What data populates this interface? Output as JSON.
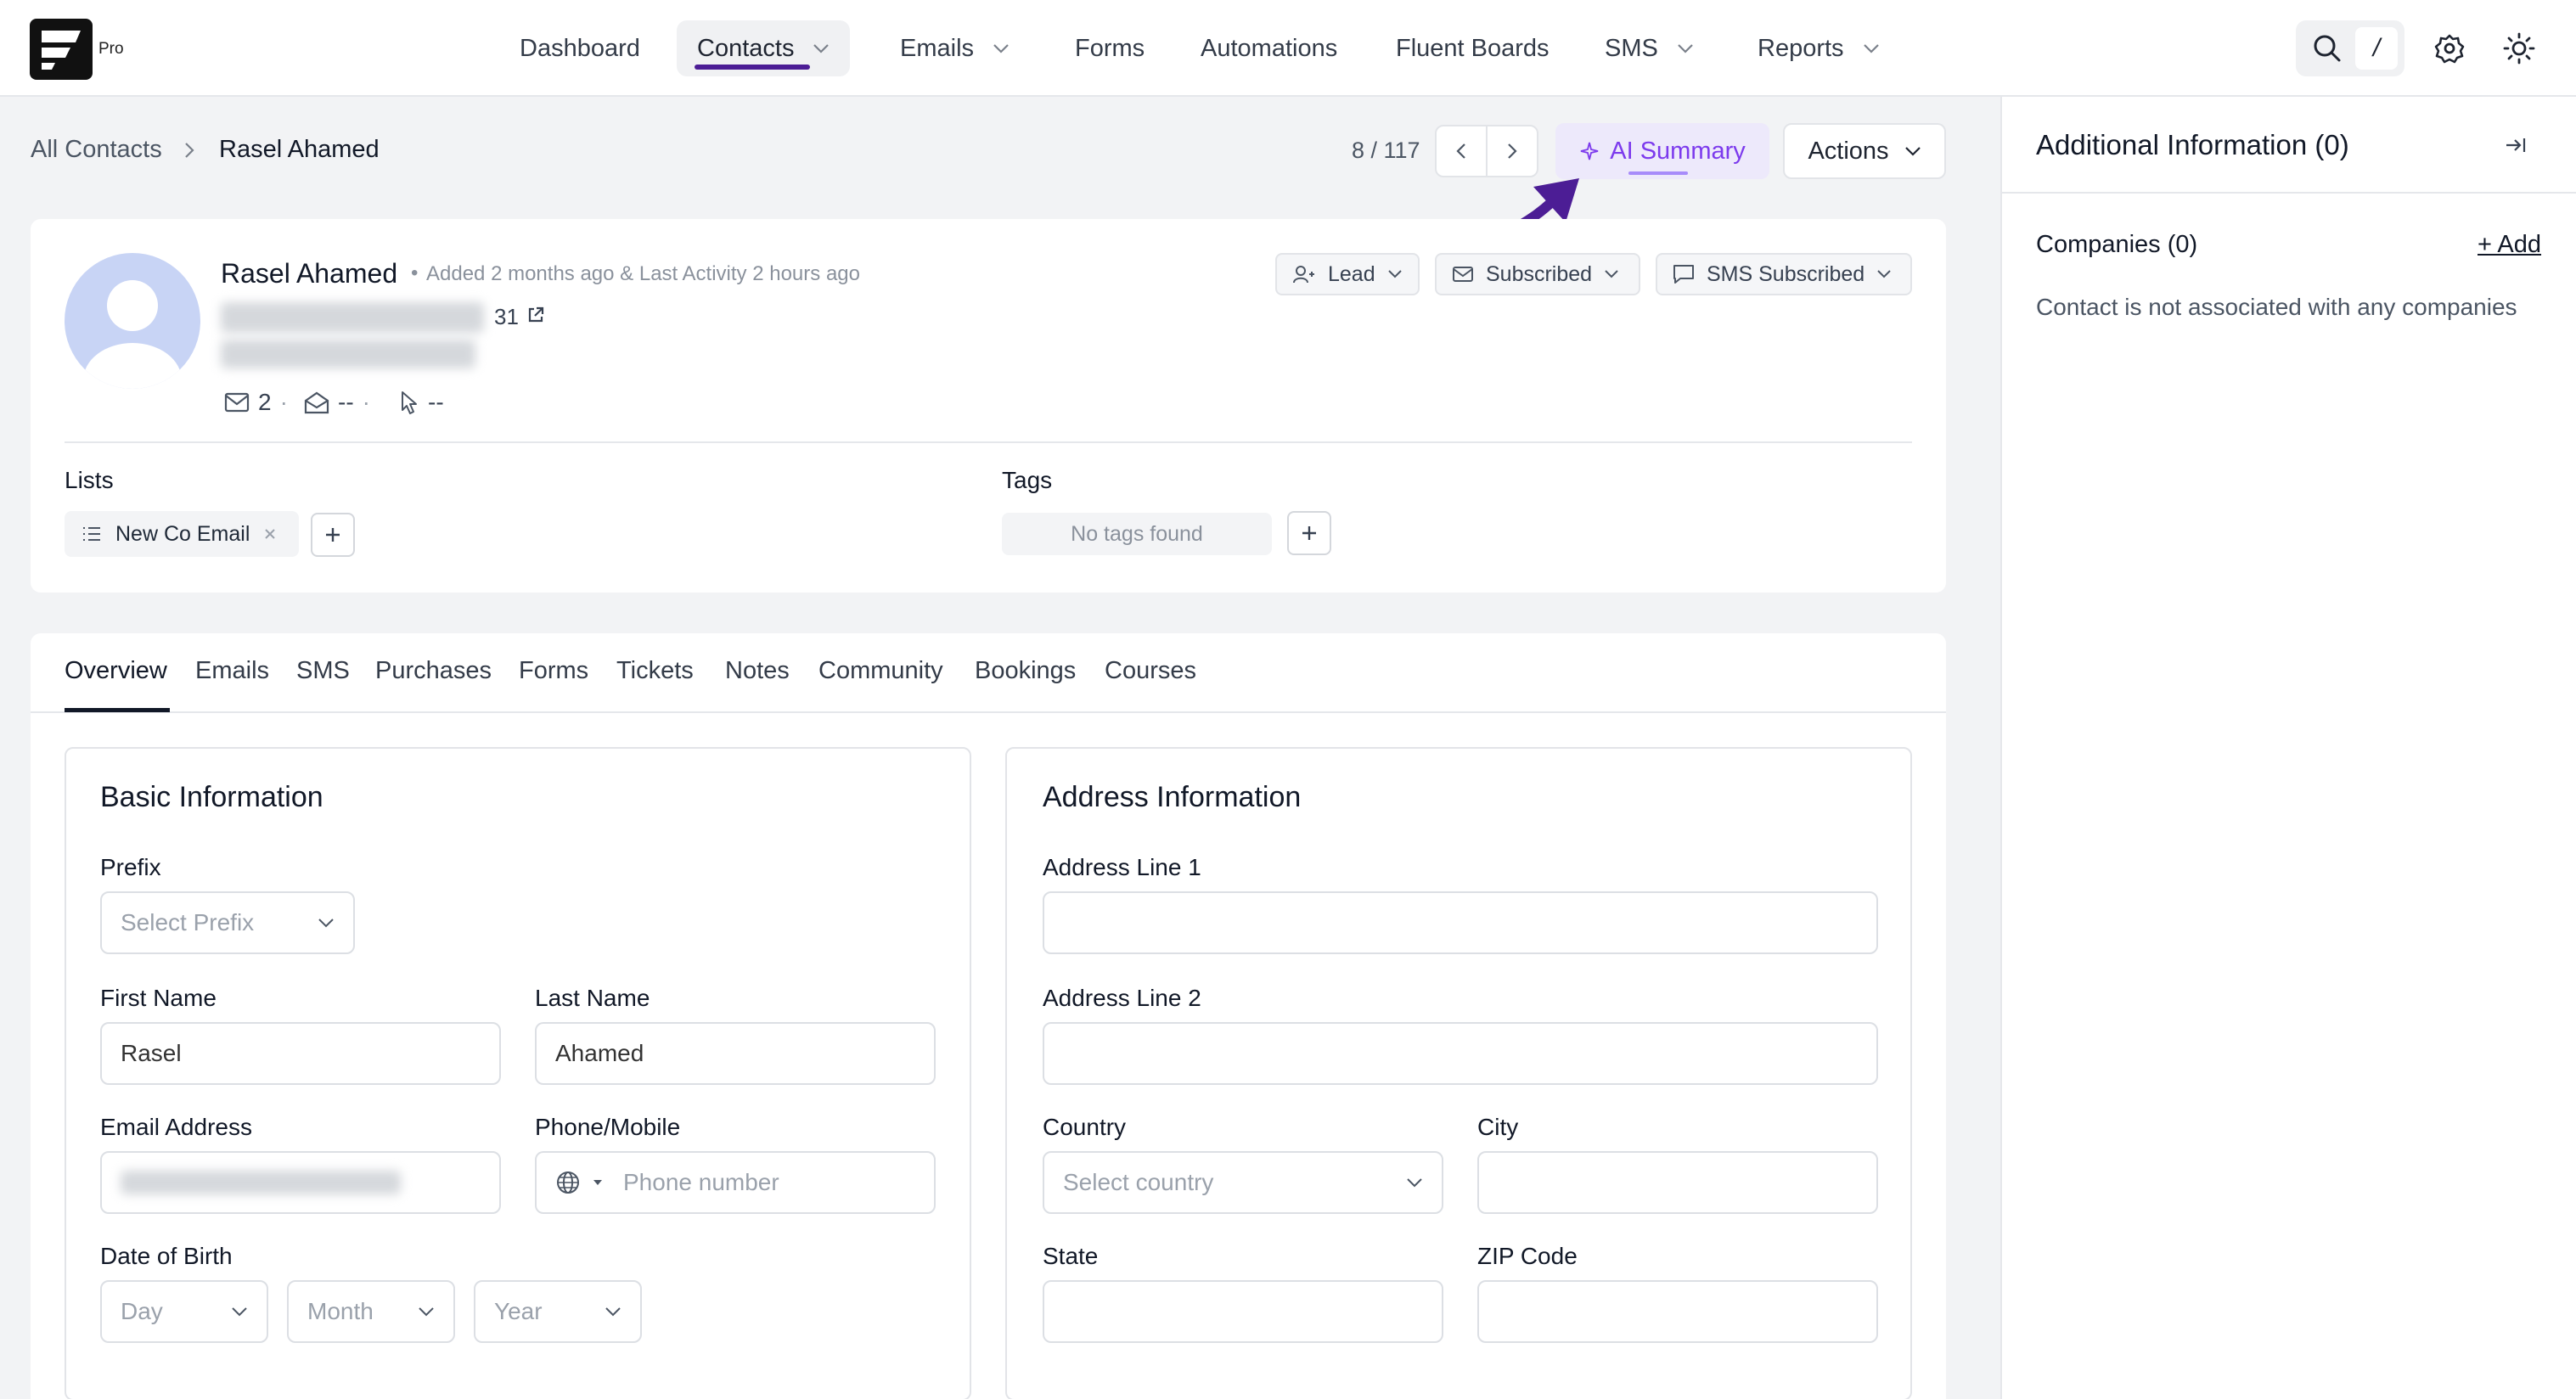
{
  "app": {
    "pro_badge": "Pro"
  },
  "nav": {
    "items": [
      {
        "label": "Dashboard"
      },
      {
        "label": "Contacts"
      },
      {
        "label": "Emails"
      },
      {
        "label": "Forms"
      },
      {
        "label": "Automations"
      },
      {
        "label": "Fluent Boards"
      },
      {
        "label": "SMS"
      },
      {
        "label": "Reports"
      }
    ],
    "active": "Contacts",
    "search_shortcut": "/",
    "icons": [
      "search-icon",
      "settings-gear-icon",
      "sun-icon"
    ]
  },
  "breadcrumb": {
    "root": "All Contacts",
    "current": "Rasel Ahamed"
  },
  "pager": {
    "position": "8 / 117"
  },
  "header_actions": {
    "ai_summary": "AI Summary",
    "actions": "Actions"
  },
  "profile": {
    "name": "Rasel Ahamed",
    "meta": "Added 2 months ago & Last Activity 2 hours ago",
    "age": "31",
    "stats": {
      "emails": "2",
      "opens": "--",
      "clicks": "--"
    },
    "status_pills": {
      "type": "Lead",
      "email_status": "Subscribed",
      "sms_status": "SMS Subscribed"
    },
    "lists_label": "Lists",
    "lists": [
      "New Co Email"
    ],
    "tags_label": "Tags",
    "tags_empty": "No tags found"
  },
  "tabs": [
    "Overview",
    "Emails",
    "SMS",
    "Purchases",
    "Forms",
    "Tickets",
    "Notes",
    "Community",
    "Bookings",
    "Courses"
  ],
  "active_tab": "Overview",
  "basic_info": {
    "title": "Basic Information",
    "prefix_label": "Prefix",
    "prefix_placeholder": "Select Prefix",
    "first_name_label": "First Name",
    "first_name": "Rasel",
    "last_name_label": "Last Name",
    "last_name": "Ahamed",
    "email_label": "Email Address",
    "phone_label": "Phone/Mobile",
    "phone_placeholder": "Phone number",
    "dob_label": "Date of Birth",
    "day_placeholder": "Day",
    "month_placeholder": "Month",
    "year_placeholder": "Year"
  },
  "address_info": {
    "title": "Address Information",
    "line1_label": "Address Line 1",
    "line2_label": "Address Line 2",
    "country_label": "Country",
    "country_placeholder": "Select country",
    "city_label": "City",
    "state_label": "State",
    "zip_label": "ZIP Code"
  },
  "sidebar": {
    "title": "Additional Information (0)",
    "companies": "Companies (0)",
    "add": "+ Add",
    "empty_text": "Contact is not associated with any companies"
  },
  "colors": {
    "accent": "#4c1d95",
    "ai": "#7c3aed",
    "avatar_bg": "#c8d4f5"
  }
}
